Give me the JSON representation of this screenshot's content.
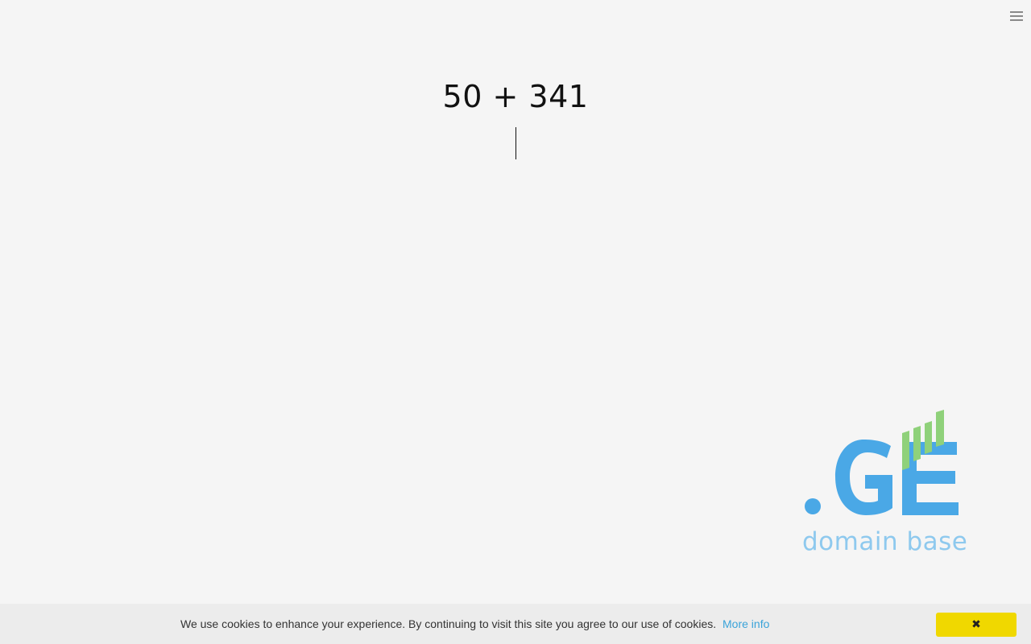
{
  "header": {
    "menu_icon": "hamburger-menu-icon"
  },
  "captcha": {
    "question": "50 + 341",
    "answer_value": ""
  },
  "logo": {
    "mark": ".GE",
    "tagline": "domain base",
    "colors": {
      "primary_blue": "#4aa8e6",
      "light_blue": "#8ec9ee",
      "green_bars": "#8fd17a"
    }
  },
  "cookie_banner": {
    "message": "We use cookies to enhance your experience. By continuing to visit this site you agree to our use of cookies.",
    "link_text": "More info",
    "close_label": "✖",
    "close_color": "#f0d800"
  }
}
